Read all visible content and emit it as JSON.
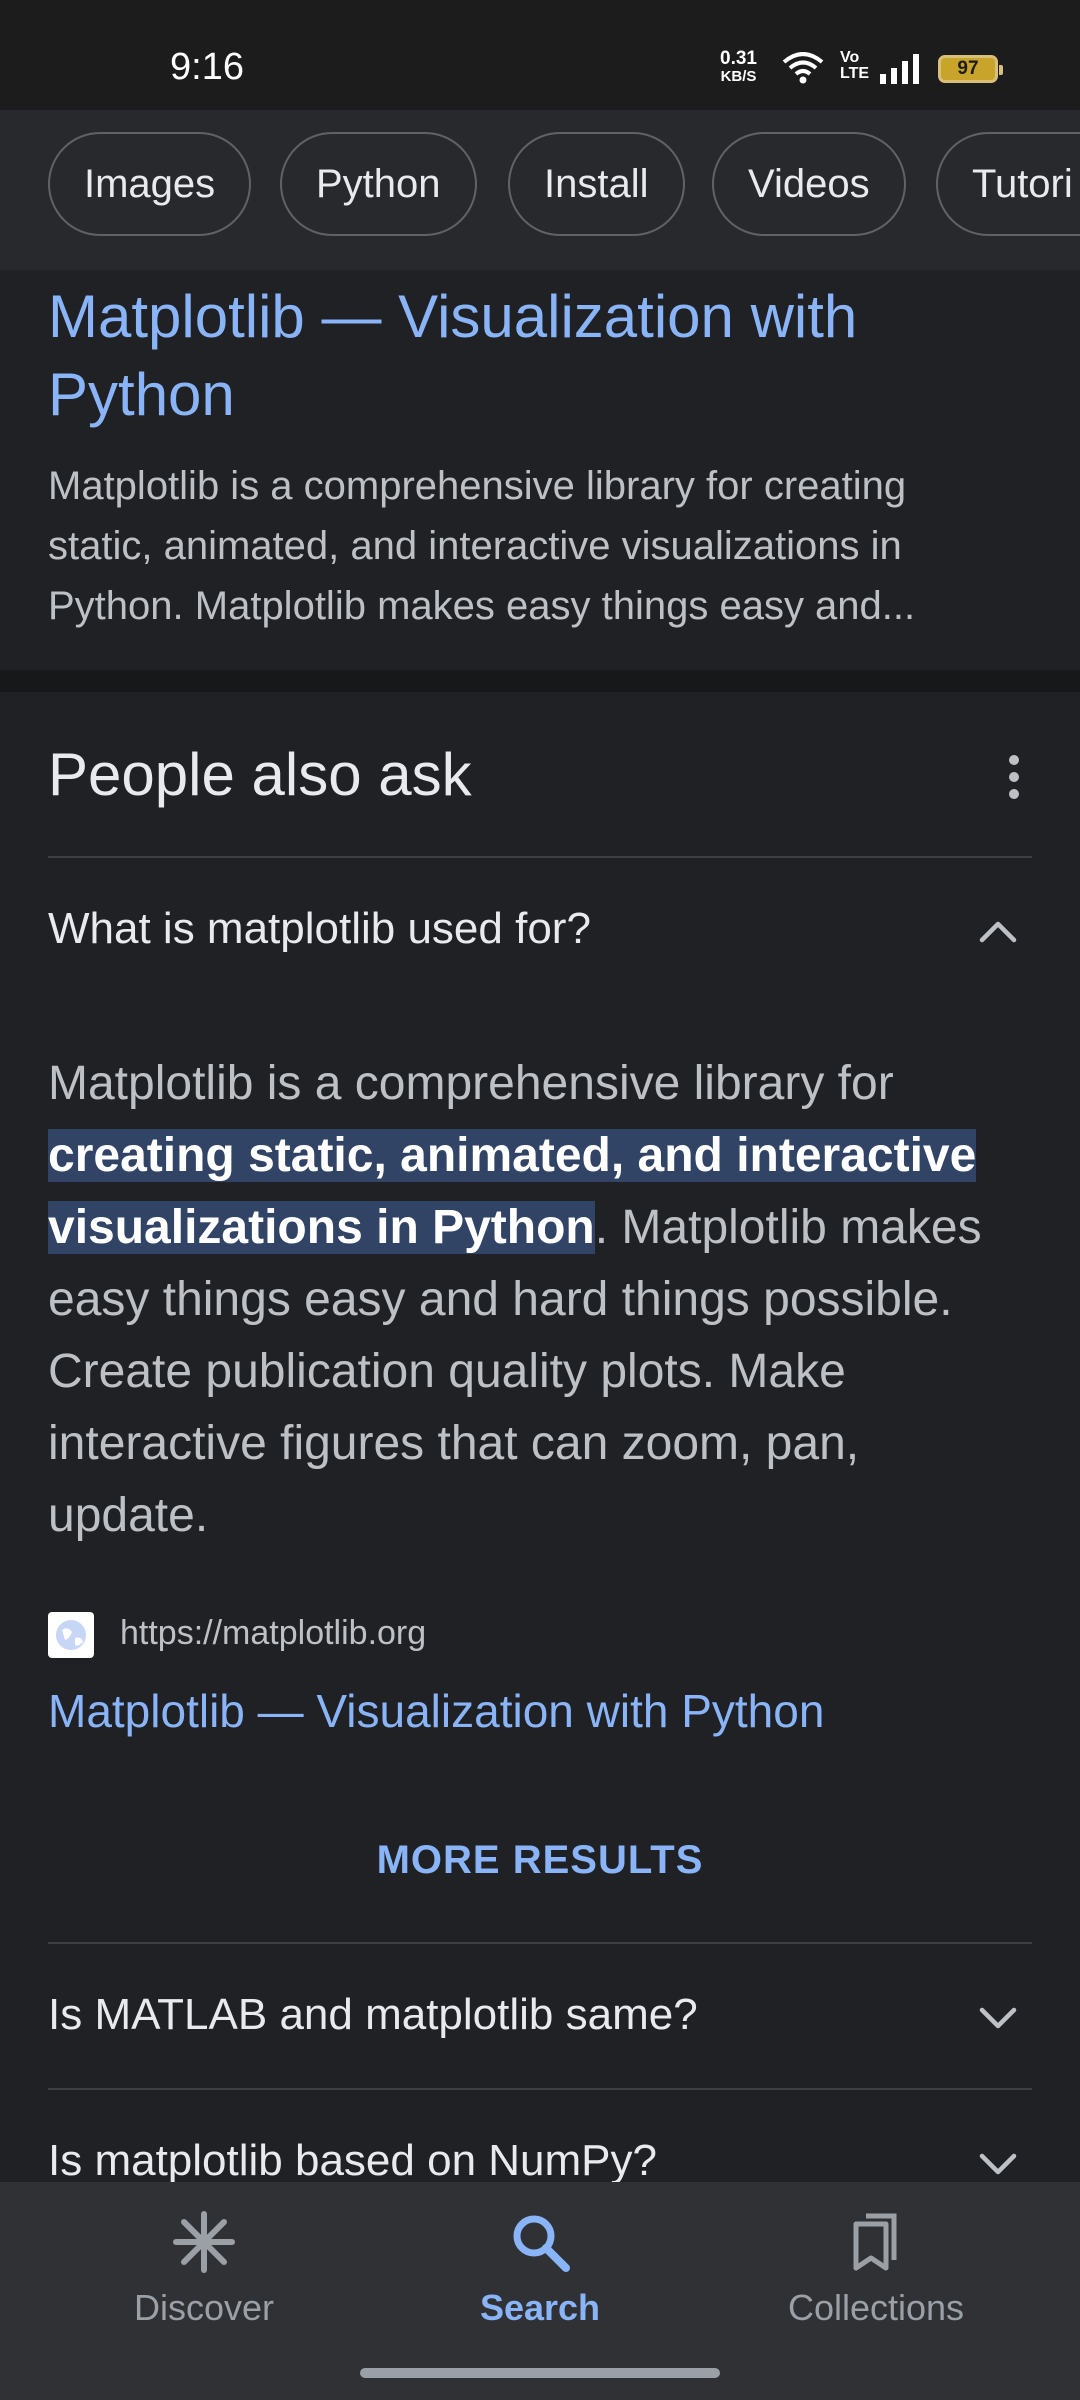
{
  "status_bar": {
    "time": "9:16",
    "net_speed_value": "0.31",
    "net_speed_unit": "KB/S",
    "volte_top": "Vo",
    "volte_bottom": "LTE",
    "battery": "97"
  },
  "chips": [
    "Images",
    "Python",
    "Install",
    "Videos",
    "Tutori"
  ],
  "result": {
    "title": "Matplotlib — Visualization with Python",
    "snippet": "Matplotlib is a comprehensive library for creating static, animated, and interactive visualizations in Python. Matplotlib makes easy things easy and..."
  },
  "people_also_ask": {
    "heading": "People also ask",
    "expanded_question": "What is matplotlib used for?",
    "answer": {
      "before": "Matplotlib is a comprehensive library for ",
      "highlight": "creating static, animated, and interactive visualizations in Python",
      "after": ". Matplotlib makes easy things easy and hard things possible. Create publication quality plots. Make interactive figures that can zoom, pan, update."
    },
    "source_url": "https://matplotlib.org",
    "source_title": "Matplotlib — Visualization with Python",
    "more_results": "MORE RESULTS",
    "collapsed_questions": [
      "Is MATLAB and matplotlib same?",
      "Is matplotlib based on NumPy?"
    ]
  },
  "bottom_nav": {
    "discover": "Discover",
    "search": "Search",
    "collections": "Collections"
  },
  "colors": {
    "background": "#202124",
    "link": "#8ab4f8",
    "highlight": "#314466",
    "nav_bg": "#303134"
  },
  "icons": [
    "wifi-icon",
    "signal-icon",
    "battery-icon",
    "more-vert-icon",
    "chevron-up-icon",
    "chevron-down-icon",
    "globe-icon",
    "discover-icon",
    "search-icon",
    "collections-icon"
  ]
}
